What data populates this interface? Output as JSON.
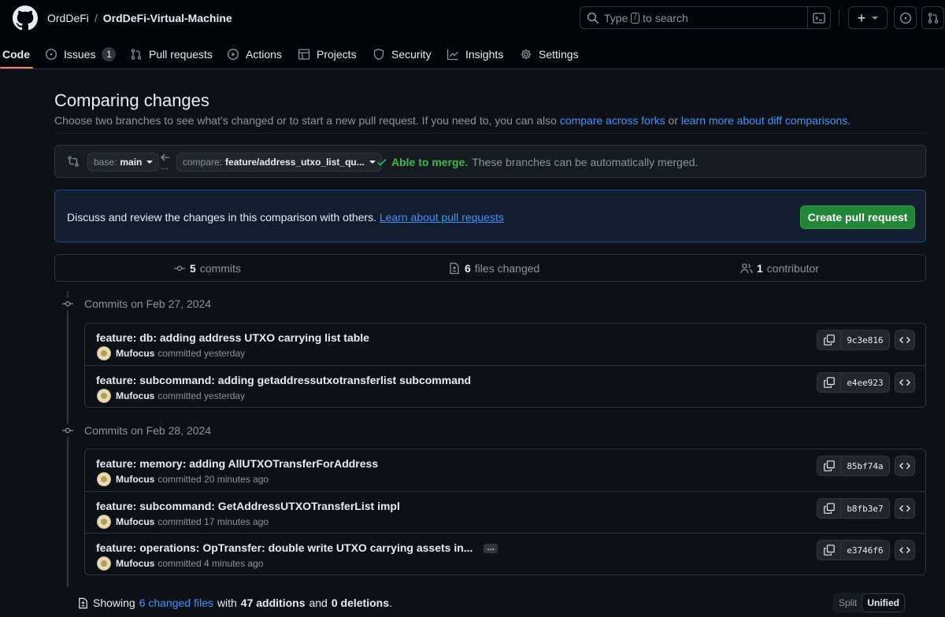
{
  "header": {
    "owner": "OrdDeFi",
    "separator": "/",
    "repo": "OrdDeFi-Virtual-Machine",
    "search_prefix": "Type",
    "search_key": "/",
    "search_suffix": "to search",
    "new_label": "+"
  },
  "tabs": [
    {
      "label": "Code",
      "icon": "code-icon"
    },
    {
      "label": "Issues",
      "icon": "issue-icon",
      "count": "1"
    },
    {
      "label": "Pull requests",
      "icon": "pull-request-icon"
    },
    {
      "label": "Actions",
      "icon": "play-icon"
    },
    {
      "label": "Projects",
      "icon": "table-icon"
    },
    {
      "label": "Security",
      "icon": "shield-icon"
    },
    {
      "label": "Insights",
      "icon": "graph-icon"
    },
    {
      "label": "Settings",
      "icon": "gear-icon"
    }
  ],
  "page": {
    "title": "Comparing changes",
    "subtitle_text": "Choose two branches to see what’s changed or to start a new pull request. If you need to, you can also",
    "subtitle_link1": "compare across forks",
    "subtitle_or": "or",
    "subtitle_link2": "learn more about diff comparisons",
    "subtitle_end": "."
  },
  "range": {
    "base_prefix": "base:",
    "base_branch": "main",
    "compare_prefix": "compare:",
    "compare_branch": "feature/address_utxo_list_qu...",
    "dots": "...",
    "merge_status": "Able to merge.",
    "merge_message": "These branches can be automatically merged."
  },
  "flash": {
    "message": "Discuss and review the changes in this comparison with others.",
    "link": "Learn about pull requests",
    "button": "Create pull request"
  },
  "summary": {
    "commits_count": "5",
    "commits_label": "commits",
    "files_count": "6",
    "files_label": "files changed",
    "contributors_count": "1",
    "contributors_label": "contributor"
  },
  "commit_groups": [
    {
      "heading": "Commits on Feb 27, 2024",
      "commits": [
        {
          "message": "feature: db: adding address UTXO carrying list table",
          "author": "Mufocus",
          "action": "committed",
          "when": "yesterday",
          "sha": "9c3e816"
        },
        {
          "message": "feature: subcommand: adding getaddressutxotransferlist subcommand",
          "author": "Mufocus",
          "action": "committed",
          "when": "yesterday",
          "sha": "e4ee923"
        }
      ]
    },
    {
      "heading": "Commits on Feb 28, 2024",
      "commits": [
        {
          "message": "feature: memory: adding AllUTXOTransferForAddress",
          "author": "Mufocus",
          "action": "committed",
          "when": "20 minutes ago",
          "sha": "85bf74a"
        },
        {
          "message": "feature: subcommand: GetAddressUTXOTransferList impl",
          "author": "Mufocus",
          "action": "committed",
          "when": "17 minutes ago",
          "sha": "b8fb3e7"
        },
        {
          "message": "feature: operations: OpTransfer: double write UTXO carrying assets in...",
          "author": "Mufocus",
          "action": "committed",
          "when": "4 minutes ago",
          "sha": "e3746f6",
          "ellipsis": "…"
        }
      ]
    }
  ],
  "footer": {
    "showing": "Showing",
    "changed_files": "6 changed files",
    "with": "with",
    "additions": "47 additions",
    "and": "and",
    "deletions": "0 deletions",
    "end": ".",
    "split": "Split",
    "unified": "Unified"
  },
  "colors": {
    "background": "#0d1117",
    "header": "#010409",
    "link": "#4493f8",
    "success": "#3fb950",
    "primary_button": "#238636",
    "active_tab": "#f78166"
  }
}
